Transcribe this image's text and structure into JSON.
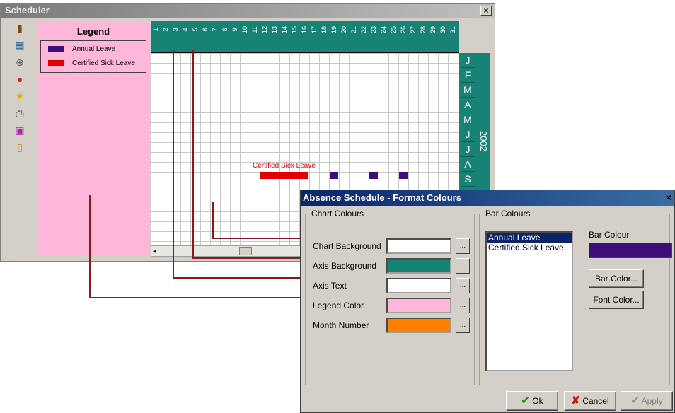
{
  "scheduler": {
    "title": "Scheduler",
    "close": "×",
    "legend": {
      "heading": "Legend",
      "items": [
        {
          "label": "Annual Leave",
          "color": "#3b0e7a"
        },
        {
          "label": "Certified Sick Leave",
          "color": "#e00000"
        }
      ]
    },
    "days": [
      "1",
      "2",
      "3",
      "4",
      "5",
      "6",
      "7",
      "8",
      "9",
      "10",
      "11",
      "12",
      "13",
      "14",
      "15",
      "16",
      "17",
      "18",
      "19",
      "20",
      "21",
      "22",
      "23",
      "24",
      "25",
      "26",
      "27",
      "28",
      "29",
      "30",
      "31"
    ],
    "months": [
      "J",
      "F",
      "M",
      "A",
      "M",
      "J",
      "J",
      "A",
      "S"
    ],
    "year": "2002",
    "chart_label": "Certified Sick Leave",
    "colors": {
      "axis_background": "#178377",
      "legend_background": "#ffb6d9",
      "chart_background": "#ffffff"
    }
  },
  "dialog": {
    "title": "Absence Schedule - Format Colours",
    "close": "×",
    "chart_colours": {
      "group_label": "Chart Colours",
      "rows": [
        {
          "label": "Chart Background",
          "color": "#ffffff",
          "button": "..."
        },
        {
          "label": "Axis Background",
          "color": "#178377",
          "button": "..."
        },
        {
          "label": "Axis Text",
          "color": "#ffffff",
          "button": "..."
        },
        {
          "label": "Legend Color",
          "color": "#ffb6d9",
          "button": "..."
        },
        {
          "label": "Month Number",
          "color": "#ff8000",
          "button": "..."
        }
      ]
    },
    "bar_colours": {
      "group_label": "Bar Colours",
      "list": [
        "Annual Leave",
        "Certified Sick Leave"
      ],
      "selected": "Annual Leave",
      "bar_colour_label": "Bar Colour",
      "bar_colour": "#3b0e7a",
      "bar_color_button": "Bar Color...",
      "font_color_button": "Font Color..."
    },
    "buttons": {
      "ok": "Ok",
      "cancel": "Cancel",
      "apply": "Apply"
    }
  }
}
